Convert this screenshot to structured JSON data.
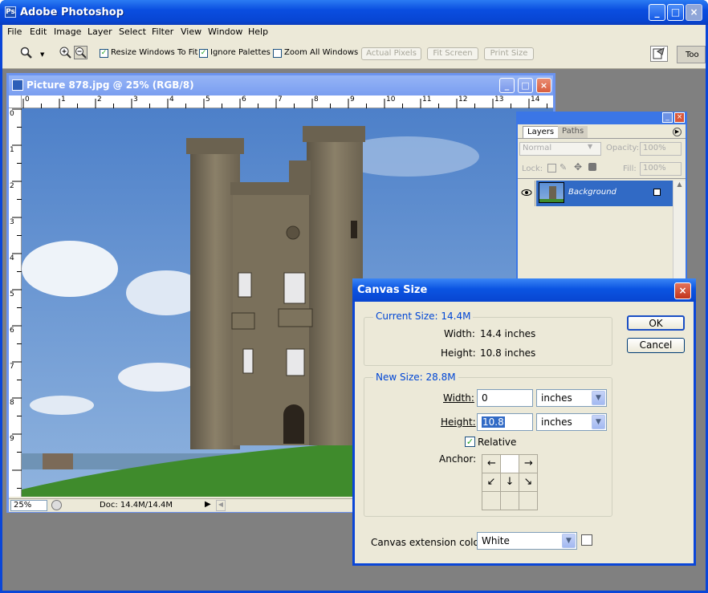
{
  "app": {
    "title": "Adobe Photoshop",
    "window_buttons": [
      "_",
      "□",
      "×"
    ]
  },
  "menu": [
    "File",
    "Edit",
    "Image",
    "Layer",
    "Select",
    "Filter",
    "View",
    "Window",
    "Help"
  ],
  "toolbar": {
    "zoom_tool_icon": "magnifier-icon",
    "resize_label": "Resize Windows To Fit",
    "ignore_label": "Ignore Palettes",
    "zoomall_label": "Zoom All Windows",
    "actual_pixels": "Actual Pixels",
    "fit_screen": "Fit Screen",
    "print_size": "Print Size",
    "palette_tab": "Too",
    "resize_checked": "✓",
    "ignore_checked": "✓"
  },
  "document": {
    "title": "Picture 878.jpg @ 25% (RGB/8)",
    "zoom": "25%",
    "doc_info": "Doc: 14.4M/14.4M",
    "ruler_h": [
      "0",
      "1",
      "2",
      "3",
      "4",
      "5",
      "6",
      "7",
      "8",
      "9",
      "10",
      "11",
      "12",
      "13",
      "14"
    ],
    "ruler_v": [
      "0",
      "1",
      "2",
      "3",
      "4",
      "5",
      "6",
      "7",
      "8",
      "9"
    ]
  },
  "layers": {
    "tab_layers": "Layers",
    "tab_paths": "Paths",
    "blend_mode": "Normal",
    "opacity_label": "Opacity:",
    "opacity": "100%",
    "lock_label": "Lock:",
    "fill_label": "Fill:",
    "fill": "100%",
    "layer_name": "Background"
  },
  "dialog": {
    "title": "Canvas Size",
    "current_title": "Current Size: 14.4M",
    "width_label": "Width:",
    "width_value": "14.4 inches",
    "height_label": "Height:",
    "height_value": "10.8 inches",
    "new_title": "New Size: 28.8M",
    "new_width_label": "Width:",
    "new_width": "0",
    "new_width_unit": "inches",
    "new_height_label": "Height:",
    "new_height": "10.8",
    "new_height_unit": "inches",
    "relative_label": "Relative",
    "relative_checked": "✓",
    "anchor_label": "Anchor:",
    "anchor_arrows": [
      "",
      "",
      "",
      "←",
      "",
      "→",
      "↙",
      "↓",
      "↘"
    ],
    "ext_color_label": "Canvas extension color:",
    "ext_color": "White",
    "ok": "OK",
    "cancel": "Cancel"
  }
}
